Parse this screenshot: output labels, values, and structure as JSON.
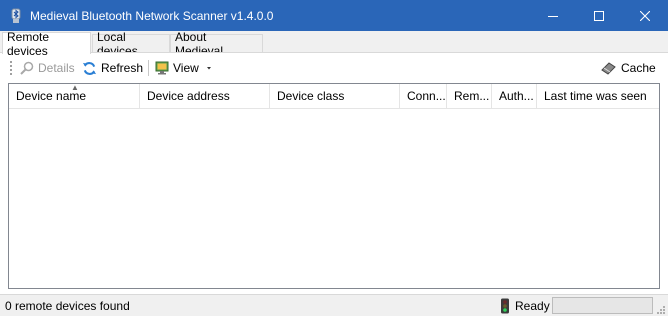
{
  "window": {
    "title": "Medieval Bluetooth Network Scanner v1.4.0.0",
    "controls": [
      "minimize",
      "maximize",
      "close"
    ]
  },
  "tabs": [
    {
      "label": "Remote devices",
      "active": true
    },
    {
      "label": "Local devices",
      "active": false
    },
    {
      "label": "About Medieval...",
      "active": false
    }
  ],
  "toolbar": {
    "details_label": "Details",
    "details_icon": "magnifier-icon",
    "refresh_label": "Refresh",
    "refresh_icon": "refresh-icon",
    "view_label": "View",
    "view_icon": "monitor-icon",
    "cache_label": "Cache",
    "cache_icon": "eraser-icon"
  },
  "grid": {
    "columns": [
      "Device name",
      "Device address",
      "Device class",
      "Conn...",
      "Rem...",
      "Auth...",
      "Last time was seen"
    ],
    "sorted_column": "Device name",
    "rows": []
  },
  "status": {
    "message": "0 remote devices found",
    "ready_label": "Ready",
    "progress_fraction": 0
  },
  "colors": {
    "titlebar": "#2a66b8",
    "progress": "#06b025"
  }
}
